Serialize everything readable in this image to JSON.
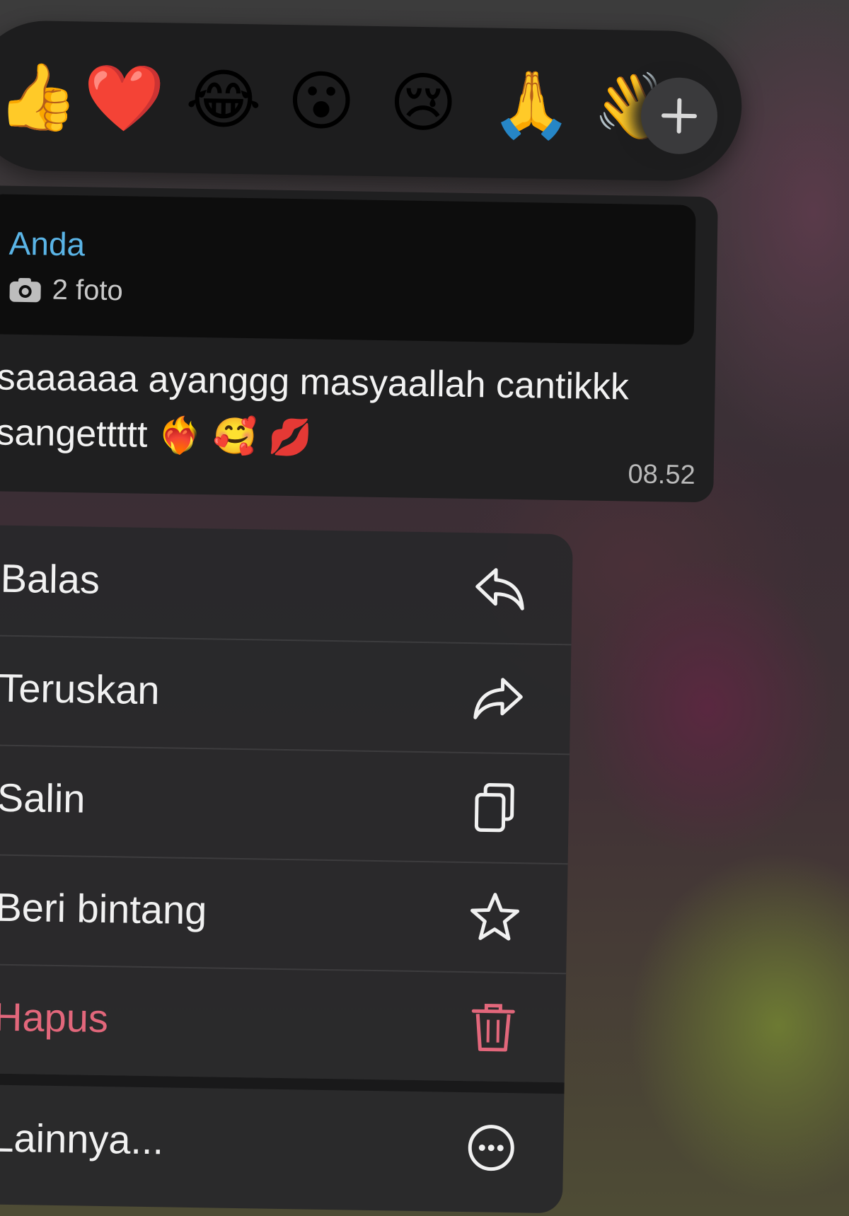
{
  "reactions": {
    "emojis": [
      "👍",
      "❤️",
      "😂",
      "😮",
      "😢",
      "🙏",
      "👋"
    ],
    "plus_label": "+"
  },
  "message": {
    "quote_name": "Anda",
    "quote_attachment": "2 foto",
    "text": "saaaaaa ayanggg masyaallah cantikkk sangettttt",
    "text_emojis": "❤️‍🔥 🥰 💋",
    "time": "08.52"
  },
  "menu": {
    "items": [
      {
        "label": "Balas",
        "icon": "reply-icon"
      },
      {
        "label": "Teruskan",
        "icon": "forward-icon"
      },
      {
        "label": "Salin",
        "icon": "copy-icon"
      },
      {
        "label": "Beri bintang",
        "icon": "star-icon"
      },
      {
        "label": "Hapus",
        "icon": "trash-icon",
        "danger": true
      },
      {
        "label": "Lainnya...",
        "icon": "more-icon"
      }
    ]
  },
  "colors": {
    "accent_name": "#5ab4e6",
    "danger": "#e2677b",
    "bubble": "#1f1f20",
    "menu": "#28282a"
  }
}
